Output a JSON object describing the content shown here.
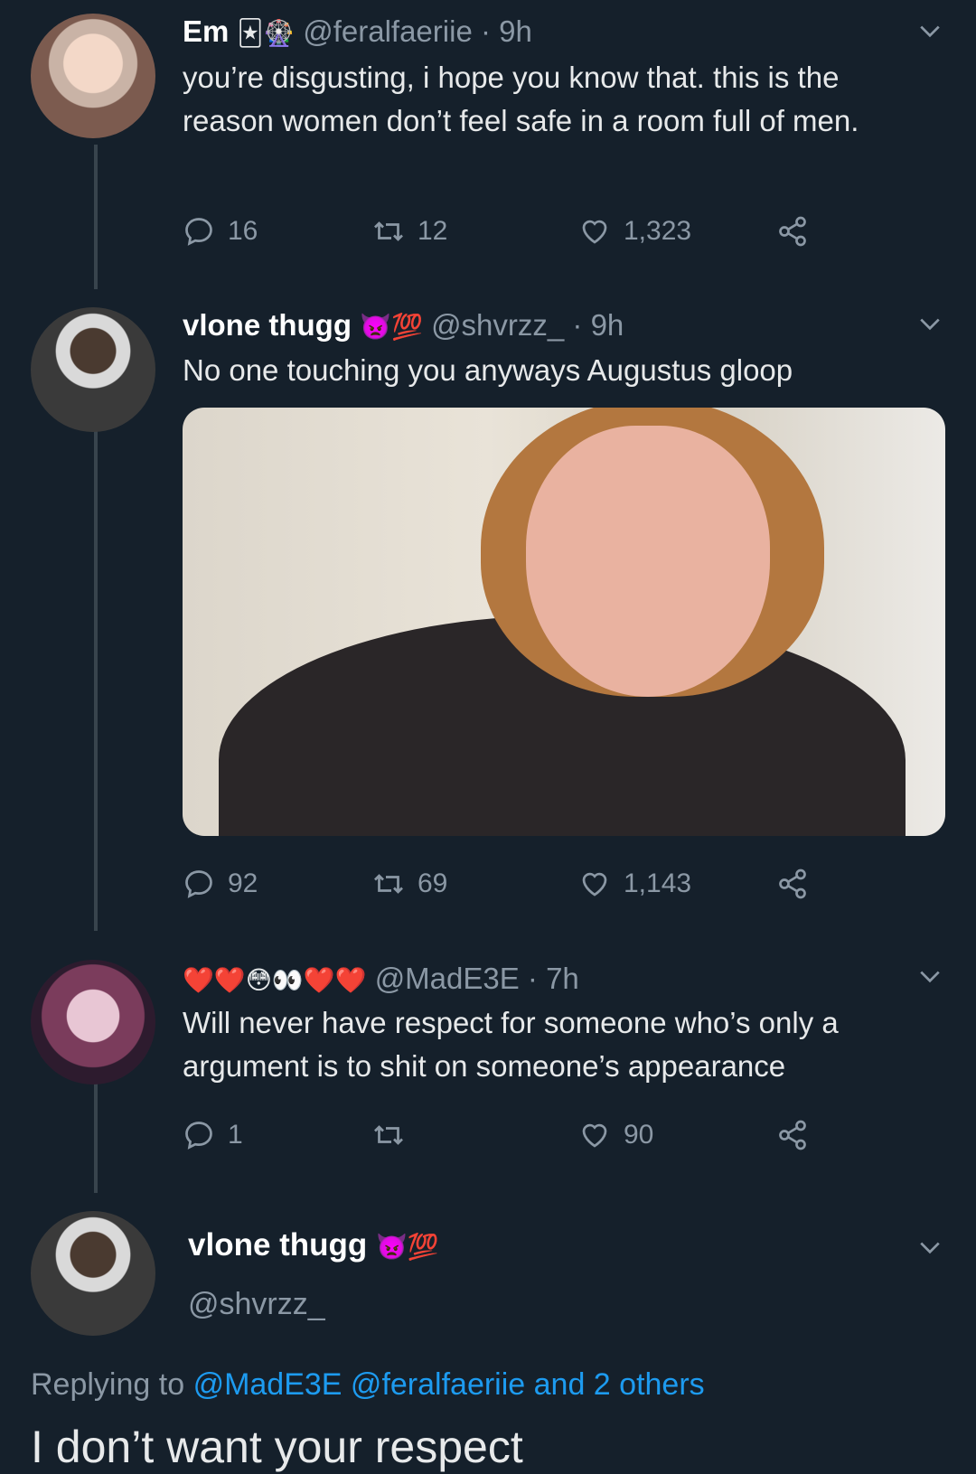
{
  "tweets": [
    {
      "name": "Em",
      "name_emojis": "🃏🎡",
      "handle_time": "@feralfaeriie · 9h",
      "text": "you’re disgusting, i hope you know that. this is the reason women don’t feel safe in a room full of men.",
      "replies": "16",
      "retweets": "12",
      "likes": "1,323"
    },
    {
      "name": "vlone thugg",
      "name_emojis": "👿💯",
      "handle_time": "@shvrzz_ · 9h",
      "text": "No one touching you anyways Augustus gloop",
      "replies": "92",
      "retweets": "69",
      "likes": "1,143"
    },
    {
      "name": "",
      "name_emojis": "❤️❤️😳👀❤️❤️",
      "handle_time": "@MadE3E · 7h",
      "text": "Will never have respect for someone who’s only a argument is to shit on someone’s appearance",
      "replies": "1",
      "retweets": "",
      "likes": "90"
    }
  ],
  "main_tweet": {
    "name": "vlone thugg",
    "name_emojis": "👿💯",
    "handle": "@shvrzz_",
    "replying_prefix": "Replying to",
    "replying_links": "@MadE3E @feralfaeriie and 2 others",
    "text": "I don’t want your respect"
  },
  "colors": {
    "background": "#15202b",
    "text": "#e7e9ea",
    "secondary": "#8b98a5",
    "link": "#1d9bf0",
    "thread_line": "#38444d"
  },
  "icons": [
    "reply-icon",
    "retweet-icon",
    "like-icon",
    "share-icon",
    "chevron-down-icon"
  ]
}
